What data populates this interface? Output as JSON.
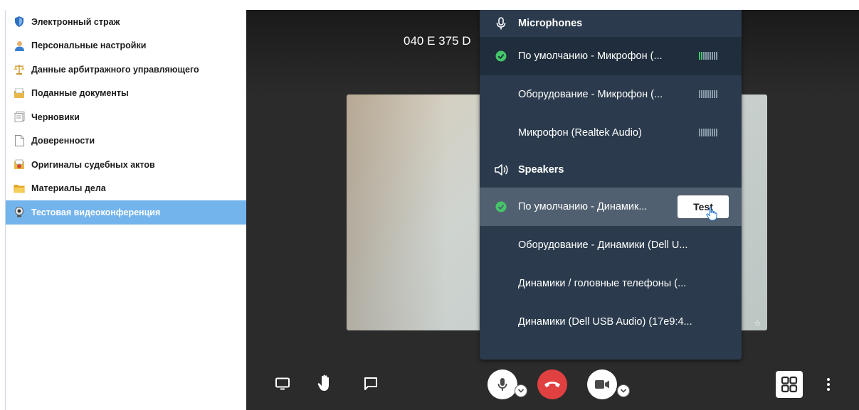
{
  "sidebar": {
    "items": [
      {
        "label": "Электронный страж",
        "icon": "shield-icon"
      },
      {
        "label": "Персональные настройки",
        "icon": "user-icon"
      },
      {
        "label": "Данные арбитражного управляющего",
        "icon": "scales-icon"
      },
      {
        "label": "Поданные документы",
        "icon": "inbox-icon"
      },
      {
        "label": "Черновики",
        "icon": "draft-icon"
      },
      {
        "label": "Доверенности",
        "icon": "document-icon"
      },
      {
        "label": "Оригиналы судебных актов",
        "icon": "court-acts-icon"
      },
      {
        "label": "Материалы дела",
        "icon": "folder-icon"
      },
      {
        "label": "Тестовая видеоконференция",
        "icon": "webcam-icon",
        "active": true
      }
    ]
  },
  "conference": {
    "room_name": "040 E 375 D"
  },
  "device_menu": {
    "microphones_header": "Microphones",
    "microphones": [
      {
        "label": "По умолчанию - Микрофон (...",
        "selected": true,
        "level": 0.2
      },
      {
        "label": "Оборудование - Микрофон (...",
        "selected": false,
        "level": 0
      },
      {
        "label": "Микрофон (Realtek Audio)",
        "selected": false,
        "level": 0
      }
    ],
    "speakers_header": "Speakers",
    "speakers": [
      {
        "label": "По умолчанию - Динамик...",
        "selected": true
      },
      {
        "label": "Оборудование - Динамики (Dell U..."
      },
      {
        "label": "Динамики / головные телефоны (..."
      },
      {
        "label": "Динамики (Dell USB Audio) (17e9:4..."
      }
    ],
    "test_label": "Test"
  },
  "colors": {
    "accent": "#74b4ec",
    "menu_bg": "#2b3b4d",
    "check": "#44c569",
    "hangup": "#e04040"
  }
}
